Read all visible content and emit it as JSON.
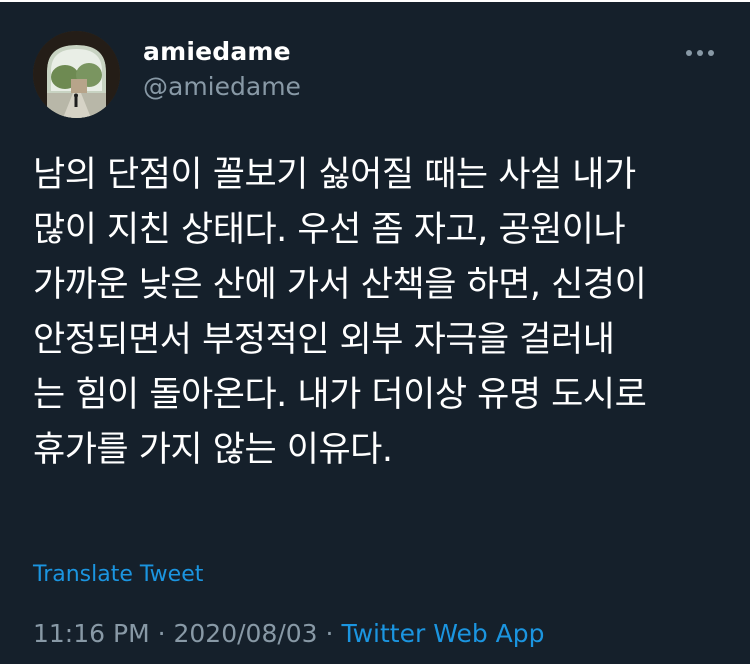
{
  "tweet": {
    "author": {
      "display_name": "amiedame",
      "handle": "@amiedame"
    },
    "text": "남의 단점이 꼴보기 싫어질 때는 사실 내가\n많이 지친 상태다. 우선 좀 자고, 공원이나\n가까운 낮은 산에 가서 산책을 하면, 신경이\n안정되면서 부정적인 외부 자극을 걸러내\n는 힘이 돌아온다. 내가 더이상 유명 도시로\n휴가를 가지 않는 이유다.",
    "translate_label": "Translate Tweet",
    "time": "11:16 PM",
    "separator": "·",
    "date": "2020/08/03",
    "source": "Twitter Web App"
  },
  "icons": {
    "more": "more-horizontal-icon"
  },
  "colors": {
    "background": "#15202b",
    "text_primary": "#ffffff",
    "text_secondary": "#8899a6",
    "link": "#1b95e0"
  }
}
